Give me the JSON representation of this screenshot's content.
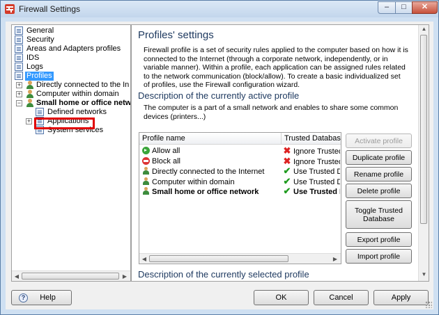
{
  "window": {
    "title": "Firewall Settings",
    "controls": {
      "minimize": "–",
      "maximize": "□",
      "close": "✕"
    }
  },
  "tree": {
    "items": [
      {
        "label": "General",
        "icon": "page-icon"
      },
      {
        "label": "Security",
        "icon": "page-icon"
      },
      {
        "label": "Areas and Adapters profiles",
        "icon": "page-icon"
      },
      {
        "label": "IDS",
        "icon": "page-icon"
      },
      {
        "label": "Logs",
        "icon": "page-icon"
      },
      {
        "label": "Profiles",
        "icon": "page-icon",
        "selected": true
      },
      {
        "label": "Directly connected to the In",
        "icon": "person-icon",
        "expander": "+"
      },
      {
        "label": "Computer within domain",
        "icon": "person-icon",
        "expander": "+"
      },
      {
        "label": "Small home or office netw",
        "icon": "person-icon",
        "expander": "−",
        "bold": true
      },
      {
        "label": "Defined networks",
        "icon": "page-icon"
      },
      {
        "label": "Applications",
        "icon": "page-icon",
        "expander": "+",
        "highlighted": true
      },
      {
        "label": "System services",
        "icon": "page-icon"
      }
    ]
  },
  "main": {
    "title": "Profiles' settings",
    "intro": "Firewall profile is a set of security rules applied to the computer based on how it is connected to the Internet (through a corporate network, independently, or in variable manner). Within a profile, each application can be assigned rules related to the network communication (block/allow). To create a basic individualized set of profiles, use the Firewall configuration wizard.",
    "active_heading": "Description of the currently active profile",
    "active_description": "The computer is a part of a small network and enables to share some common devices (printers...)",
    "selected_heading": "Description of the currently selected profile",
    "table": {
      "columns": [
        "Profile name",
        "Trusted Database"
      ],
      "rows": [
        {
          "name": "Allow all",
          "icon": "allow-icon",
          "status_icon": "x",
          "trusted": "Ignore Trusted",
          "bold": false
        },
        {
          "name": "Block all",
          "icon": "block-icon",
          "status_icon": "x",
          "trusted": "Ignore Trusted",
          "bold": false
        },
        {
          "name": "Directly connected to the Internet",
          "icon": "person-icon",
          "status_icon": "check",
          "trusted": "Use Trusted Da",
          "bold": false
        },
        {
          "name": "Computer within domain",
          "icon": "person-icon",
          "status_icon": "check",
          "trusted": "Use Trusted Da",
          "bold": false
        },
        {
          "name": "Small home or office network",
          "icon": "person-icon",
          "status_icon": "check",
          "trusted": "Use Trusted D",
          "bold": true
        }
      ]
    },
    "buttons": {
      "activate": "Activate profile",
      "duplicate": "Duplicate profile",
      "rename": "Rename profile",
      "delete": "Delete profile",
      "toggle": "Toggle Trusted Database",
      "export": "Export profile",
      "import": "Import profile"
    }
  },
  "footer": {
    "help": "Help",
    "ok": "OK",
    "cancel": "Cancel",
    "apply": "Apply"
  },
  "colors": {
    "heading": "#1f3a60",
    "selection": "#3399ff",
    "highlight_box": "#e00000"
  }
}
